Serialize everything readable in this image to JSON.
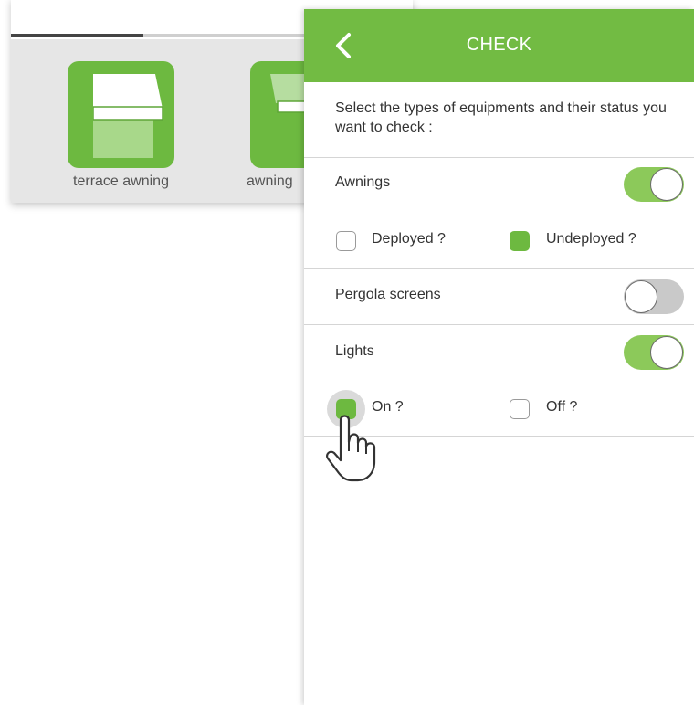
{
  "background": {
    "slider_progress": 0.33,
    "tiles": [
      {
        "label": "terrace awning",
        "icon": "terrace-awning-icon"
      },
      {
        "label": "awning",
        "icon": "awning-icon"
      }
    ]
  },
  "panel": {
    "title": "CHECK",
    "back_icon": "chevron-left-icon",
    "intro": "Select the types of equipments and their status you want to check :",
    "sections": [
      {
        "label": "Awnings",
        "enabled": true,
        "options": [
          {
            "label": "Deployed ?",
            "checked": false
          },
          {
            "label": "Undeployed ?",
            "checked": true
          }
        ]
      },
      {
        "label": "Pergola screens",
        "enabled": false,
        "options": []
      },
      {
        "label": "Lights",
        "enabled": true,
        "options": [
          {
            "label": "On ?",
            "checked": true
          },
          {
            "label": "Off ?",
            "checked": false
          }
        ]
      }
    ]
  },
  "colors": {
    "accent": "#72bb43",
    "toggle_on": "#8cc95a",
    "toggle_off": "#c9c9c9",
    "tile_bg": "#6db940"
  }
}
